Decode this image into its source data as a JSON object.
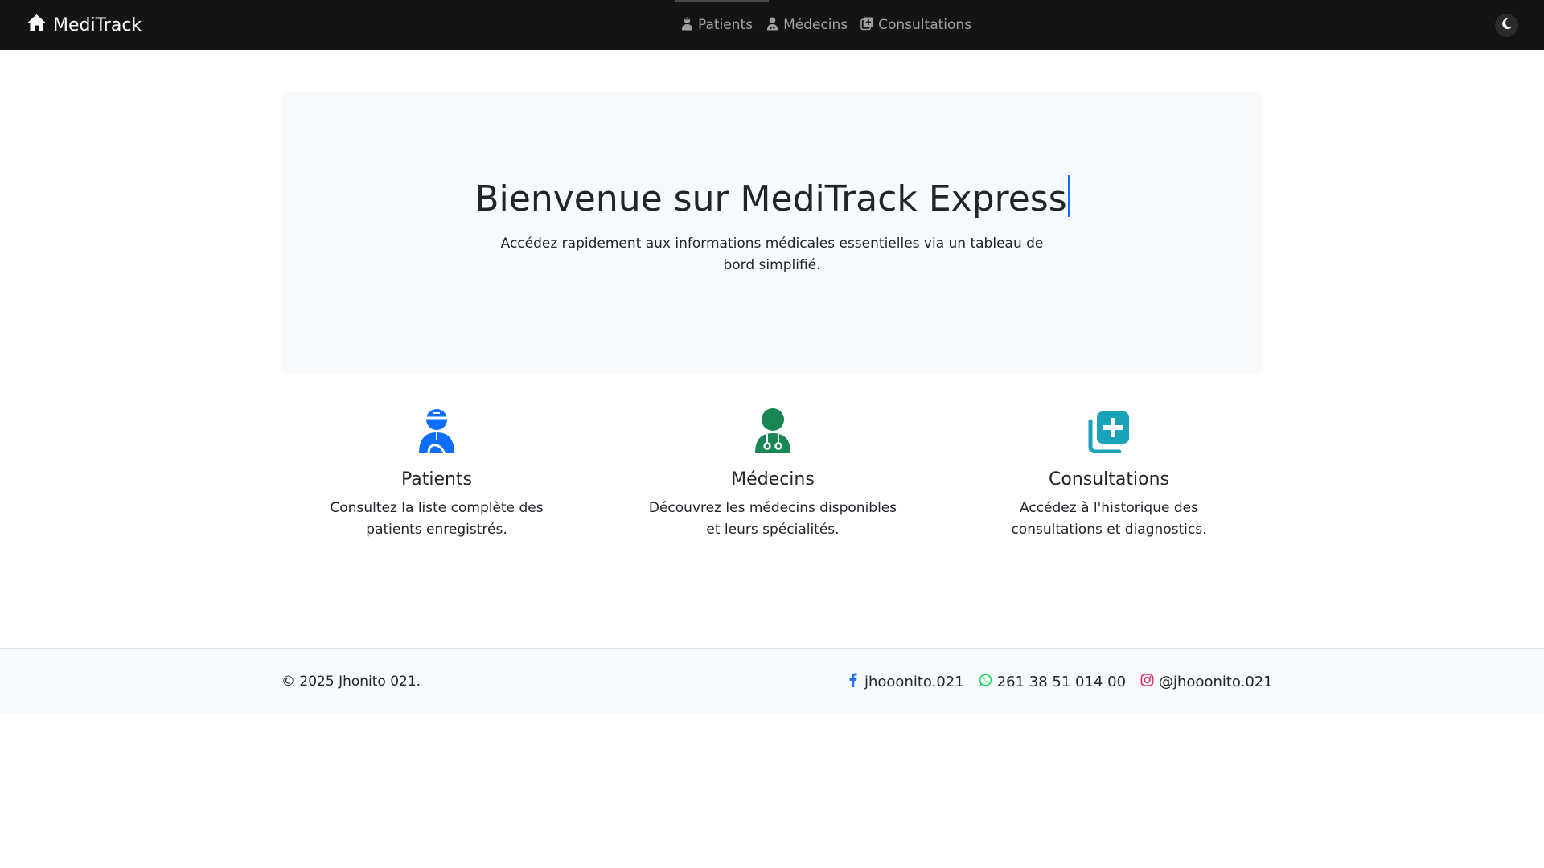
{
  "navbar": {
    "brand": "MediTrack",
    "brand_icon": "home-icon",
    "links": [
      {
        "label": "Patients",
        "icon": "user-injured-icon"
      },
      {
        "label": "Médecins",
        "icon": "user-doctor-icon"
      },
      {
        "label": "Consultations",
        "icon": "notes-medical-icon"
      }
    ],
    "theme_toggle_icon": "moon-icon"
  },
  "hero": {
    "title": "Bienvenue sur MediTrack Express",
    "subtitle": "Accédez rapidement aux informations médicales essentielles via un tableau de bord simplifié."
  },
  "features": [
    {
      "title": "Patients",
      "description": "Consultez la liste complète des patients enregistrés.",
      "icon": "user-injured-icon",
      "color": "#0d6efd"
    },
    {
      "title": "Médecins",
      "description": "Découvrez les médecins disponibles et leurs spécialités.",
      "icon": "user-doctor-icon",
      "color": "#198754"
    },
    {
      "title": "Consultations",
      "description": "Accédez à l'historique des consultations et diagnostics.",
      "icon": "notes-medical-icon",
      "color": "#0dcaf0"
    }
  ],
  "footer": {
    "copyright": "© 2025 Jhonito 021.",
    "socials": [
      {
        "label": "jhooonito.021",
        "icon": "facebook-icon",
        "color": "#1877f2"
      },
      {
        "label": "261 38 51 014 00",
        "icon": "whatsapp-icon",
        "color": "#25d366"
      },
      {
        "label": "@jhooonito.021",
        "icon": "instagram-icon",
        "color": "#e1306c"
      }
    ]
  },
  "colors": {
    "navbar_bg": "#141414",
    "nav_link": "#9ea1a4",
    "hero_bg": "#f8f9fa",
    "accent": "#0d6efd"
  }
}
